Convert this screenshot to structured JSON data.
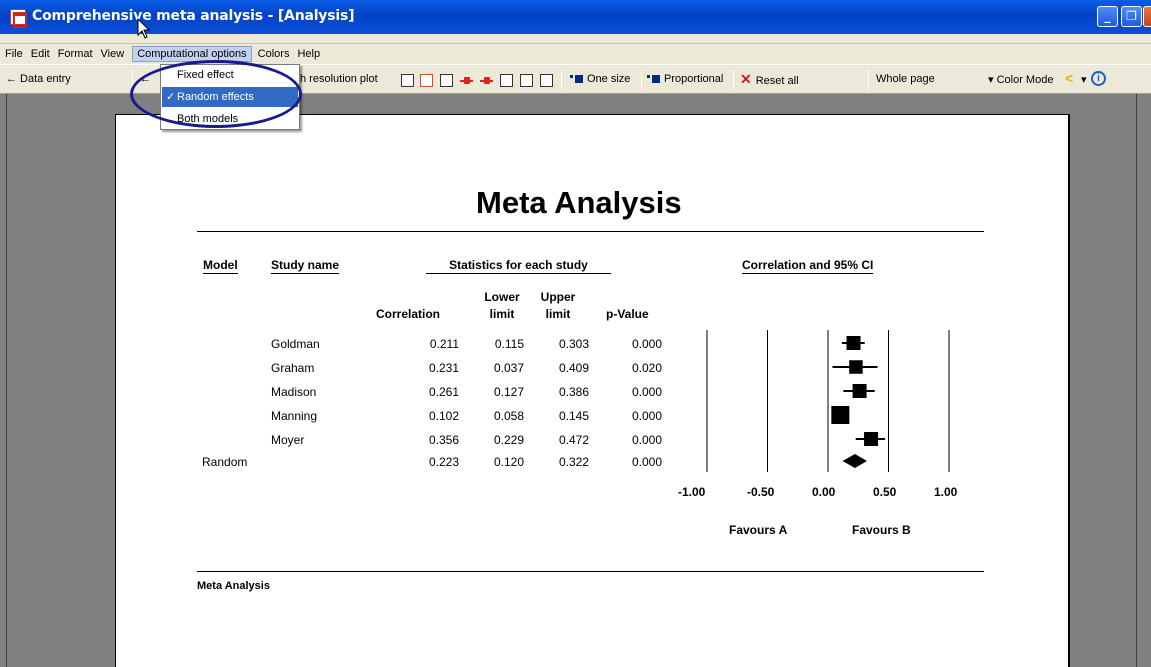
{
  "window": {
    "title": "Comprehensive meta analysis - [Analysis]",
    "buttons": {
      "minimize": "_",
      "restore": "❐"
    }
  },
  "menubar": {
    "items": [
      "File",
      "Edit",
      "Format",
      "View",
      "Computational options",
      "Colors",
      "Help"
    ]
  },
  "toolbar": {
    "data_entry": "← Data entry",
    "back_arrow": "←",
    "high_res": "h resolution plot",
    "one_size": "One size",
    "proportional": "Proportional",
    "reset_all": "Reset all",
    "whole_page": "Whole page",
    "color_mode": "▾ Color Mode",
    "more": "▾"
  },
  "dropdown": {
    "items": [
      {
        "label": "Fixed effect",
        "checked": false
      },
      {
        "label": "Random effects",
        "checked": true
      },
      {
        "label": "Both models",
        "checked": false
      }
    ],
    "check_glyph": "✓"
  },
  "report": {
    "title": "Meta Analysis",
    "footer_title": "Meta Analysis",
    "col_model": "Model",
    "col_study": "Study name",
    "col_stats": "Statistics for each study",
    "col_ci": "Correlation and 95% CI",
    "sub_correlation": "Correlation",
    "sub_lower_1": "Lower",
    "sub_lower_2": "limit",
    "sub_upper_1": "Upper",
    "sub_upper_2": "limit",
    "sub_pvalue": "p-Value",
    "favours_a": "Favours A",
    "favours_b": "Favours B",
    "axis_ticks": [
      "-1.00",
      "-0.50",
      "0.00",
      "0.50",
      "1.00"
    ]
  },
  "chart_data": {
    "type": "forest",
    "x_axis": {
      "ticks": [
        -1.0,
        -0.5,
        0.0,
        0.5,
        1.0
      ],
      "range": [
        -1.0,
        1.0
      ]
    },
    "studies": [
      {
        "name": "Goldman",
        "correlation": "0.211",
        "lower": "0.115",
        "upper": "0.303",
        "p": "0.000",
        "r": 0.211,
        "lo": 0.115,
        "hi": 0.303,
        "weight": 0.6
      },
      {
        "name": "Graham",
        "correlation": "0.231",
        "lower": "0.037",
        "upper": "0.409",
        "p": "0.020",
        "r": 0.231,
        "lo": 0.037,
        "hi": 0.409,
        "weight": 0.55
      },
      {
        "name": "Madison",
        "correlation": "0.261",
        "lower": "0.127",
        "upper": "0.386",
        "p": "0.000",
        "r": 0.261,
        "lo": 0.127,
        "hi": 0.386,
        "weight": 0.6
      },
      {
        "name": "Manning",
        "correlation": "0.102",
        "lower": "0.058",
        "upper": "0.145",
        "p": "0.000",
        "r": 0.102,
        "lo": 0.058,
        "hi": 0.145,
        "weight": 1.0
      },
      {
        "name": "Moyer",
        "correlation": "0.356",
        "lower": "0.229",
        "upper": "0.472",
        "p": "0.000",
        "r": 0.356,
        "lo": 0.229,
        "hi": 0.472,
        "weight": 0.6
      }
    ],
    "summary": {
      "model": "Random",
      "correlation": "0.223",
      "lower": "0.120",
      "upper": "0.322",
      "p": "0.000",
      "r": 0.223,
      "lo": 0.12,
      "hi": 0.322
    }
  }
}
